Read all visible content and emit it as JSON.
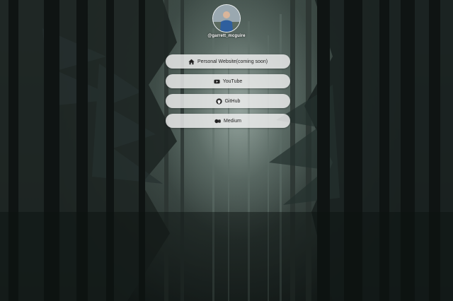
{
  "profile": {
    "handle": "@garrett_mcguire"
  },
  "links": [
    {
      "label": "Personal Website(coming soon)",
      "icon": "home-icon"
    },
    {
      "label": "YouTube",
      "icon": "youtube-icon"
    },
    {
      "label": "GitHub",
      "icon": "github-icon"
    },
    {
      "label": "Medium",
      "icon": "medium-icon"
    }
  ],
  "colors": {
    "button_bg": "#f0f0f0",
    "button_text": "#222222",
    "handle_text": "#ffffff",
    "background": "#1b2220"
  }
}
